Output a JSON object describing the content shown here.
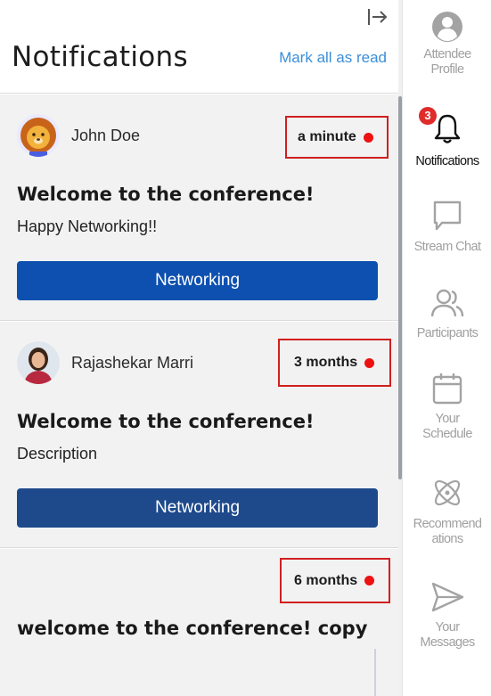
{
  "header": {
    "title": "Notifications",
    "mark_all_label": "Mark all as read"
  },
  "notifications": [
    {
      "sender": "John Doe",
      "time": "a minute",
      "title": "Welcome to the conference!",
      "description": "Happy Networking!!",
      "button_label": "Networking",
      "button_color": "#0e50b0",
      "unread": true
    },
    {
      "sender": "Rajashekar Marri",
      "time": "3 months",
      "title": "Welcome to the conference!",
      "description": "Description",
      "button_label": "Networking",
      "button_color": "#1e4a8c",
      "unread": true
    },
    {
      "time": "6 months",
      "title": "welcome to the conference! copy",
      "unread": true
    }
  ],
  "sidebar": {
    "items": [
      {
        "label_line1": "Attendee",
        "label_line2": "Profile",
        "icon": "user-circle-icon"
      },
      {
        "label_line1": "Notifications",
        "label_line2": "",
        "icon": "bell-icon",
        "badge": "3",
        "active": true
      },
      {
        "label_line1": "Stream Chat",
        "label_line2": "",
        "icon": "chat-bubble-icon"
      },
      {
        "label_line1": "Participants",
        "label_line2": "",
        "icon": "people-icon"
      },
      {
        "label_line1": "Your",
        "label_line2": "Schedule",
        "icon": "calendar-icon"
      },
      {
        "label_line1": "Recommend",
        "label_line2": "ations",
        "icon": "atom-icon"
      },
      {
        "label_line1": "Your",
        "label_line2": "Messages",
        "icon": "send-icon"
      }
    ]
  },
  "colors": {
    "accent_link": "#3b8fd9",
    "unread_dot": "#ee1111",
    "highlight_border": "#d11f1f",
    "badge": "#e02b2b",
    "card_bg": "#f2f2f2"
  }
}
